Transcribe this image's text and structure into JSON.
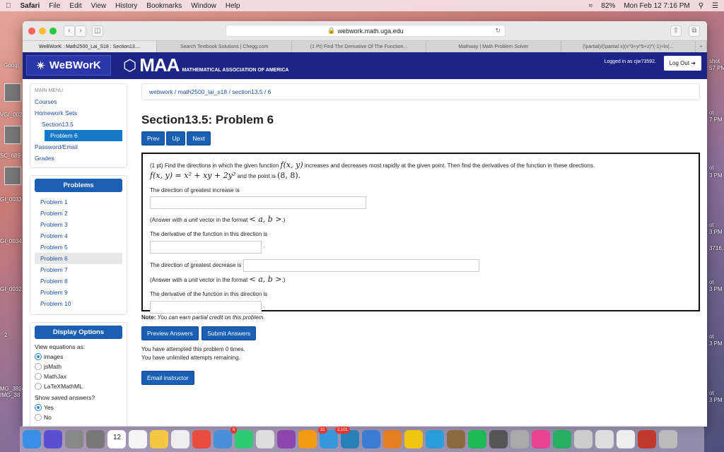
{
  "menubar": {
    "items": [
      "Safari",
      "File",
      "Edit",
      "View",
      "History",
      "Bookmarks",
      "Window",
      "Help"
    ],
    "battery": "82%",
    "clock": "Mon Feb 12  7:16 PM"
  },
  "desktop": {
    "labels": [
      "Googl",
      "VGI_002",
      "SC_689",
      "GI_0033",
      "GI_0034",
      "GI_0032",
      "2",
      "MG_3824",
      "IMG_38"
    ],
    "right_labels": [
      "shot",
      "57 PM",
      "ot",
      "7 PM",
      "ot",
      "3 PM",
      "ot",
      "3 PM",
      "3716...",
      "ot",
      "3 PM",
      "ot",
      "3 PM",
      "ot",
      "3 PM"
    ]
  },
  "browser": {
    "url": "webwork.math.uga.edu",
    "tabs": [
      "WeBWorK : Math2500_Lai_S18 : Section13....",
      "Search Textbook Solutions | Chegg.com",
      "(1 Pt) Find The Derivative Of The Function...",
      "Mathway | Math Problem Solver",
      "(\\partial)/(\\partial x)(x^3+y^5+z)^(-1)+ln(..."
    ]
  },
  "header": {
    "logo": "WeBWorK",
    "maa": "MAA",
    "maa_full": "MATHEMATICAL ASSOCIATION OF AMERICA",
    "logged_in": "Logged in as cjw73592.",
    "logout": "Log Out"
  },
  "sidebar": {
    "main_menu": "MAIN MENU",
    "courses": "Courses",
    "homework_sets": "Homework Sets",
    "section": "Section13.5",
    "problem": "Problem 6",
    "password": "Password/Email",
    "grades": "Grades",
    "problems_title": "Problems",
    "problems": [
      "Problem 1",
      "Problem 2",
      "Problem 3",
      "Problem 4",
      "Problem 5",
      "Problem 6",
      "Problem 7",
      "Problem 8",
      "Problem 9",
      "Problem 10"
    ],
    "display_title": "Display Options",
    "view_eq": "View equations as:",
    "eq_options": [
      "images",
      "jsMath",
      "MathJax",
      "LaTeXMathML"
    ],
    "eq_selected": "images",
    "show_saved": "Show saved answers?",
    "saved_options": [
      "Yes",
      "No"
    ],
    "saved_selected": "Yes"
  },
  "main": {
    "breadcrumb": "webwork / math2500_lai_s18 / section13.5 / 6",
    "title": "Section13.5: Problem 6",
    "nav": [
      "Prev",
      "Up",
      "Next"
    ],
    "problem": {
      "intro": "(1 pt) Find the directions in which the given function ",
      "fxy": "f(x, y)",
      "intro2": " increases and decreases most rapidly at the given point. Then find the derivatives of the function in these directions.",
      "func": "f(x, y) = x² + xy + 2y²",
      "and_point": " and the point is ",
      "point": "(8, 8).",
      "q1": "The direction of greatest increase is",
      "hint": "(Answer with a ",
      "unit": "unit",
      "hint2": " vector in the format ",
      "fmt": "< a, b >",
      "hint3": ".)",
      "q2": "The derivative of the function in this direction is",
      "q3": "The direction of greatest decrease is",
      "q4": "The derivative of the function in this direction is",
      "dot": "."
    },
    "note_label": "Note:",
    "note": " You can earn partial credit on this problem.",
    "preview": "Preview Answers",
    "submit": "Submit Answers",
    "attempted": "You have attempted this problem 0 times.",
    "remaining": "You have unlimited attempts remaining.",
    "email": "Email instructor"
  },
  "dock": {
    "badges": [
      "12",
      "6",
      "31",
      "2,101"
    ]
  }
}
